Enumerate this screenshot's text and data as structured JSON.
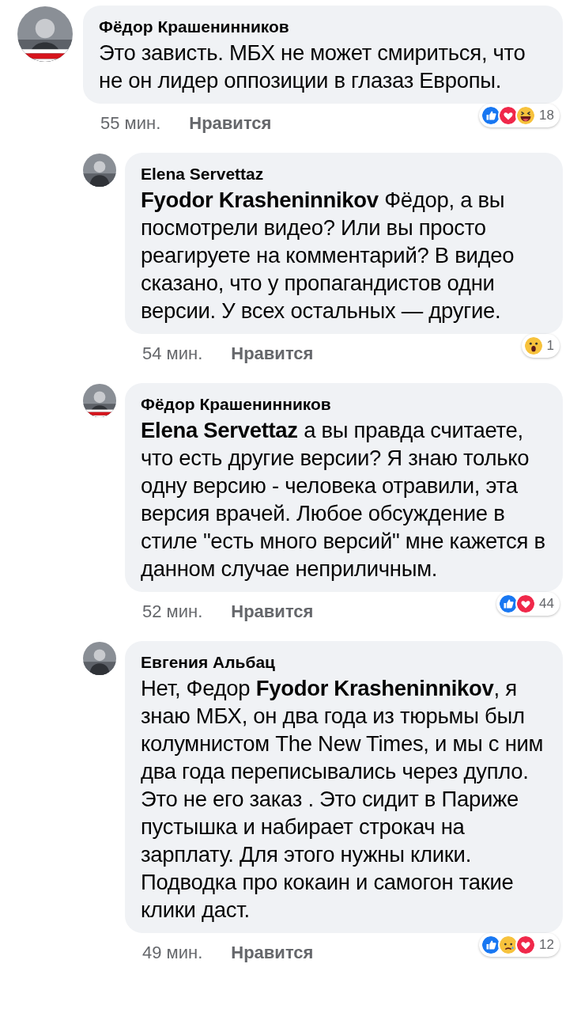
{
  "comments": [
    {
      "kind": "top",
      "author": "Фёдор Крашенинников",
      "avatar_frame": true,
      "text": "Это зависть. МБХ не может смириться, что не он лидер оппозиции в глазаз Европы.",
      "time": "55 мин.",
      "like_label": "Нравится",
      "reactions": [
        {
          "kind": "like"
        },
        {
          "kind": "love"
        },
        {
          "kind": "haha"
        }
      ],
      "reaction_count": "18"
    },
    {
      "kind": "reply",
      "author": "Elena Servettaz",
      "avatar_frame": false,
      "text": "**Fyodor Krasheninnikov** Фёдор, а вы посмотрели видео? Или вы просто реагируете на комментарий? В видео сказано, что у пропагандистов одни версии. У всех остальных — другие.",
      "time": "54 мин.",
      "like_label": "Нравится",
      "reactions": [
        {
          "kind": "wow"
        }
      ],
      "reaction_count": "1"
    },
    {
      "kind": "reply",
      "author": "Фёдор Крашенинников",
      "avatar_frame": true,
      "text": "**Elena Servettaz** а вы правда считаете, что есть другие версии? Я знаю только одну версию - человека отравили, эта версия врачей. Любое обсуждение в стиле \"есть много версий\" мне кажется в данном случае неприличным.",
      "time": "52 мин.",
      "like_label": "Нравится",
      "reactions": [
        {
          "kind": "like"
        },
        {
          "kind": "love"
        }
      ],
      "reaction_count": "44"
    },
    {
      "kind": "reply",
      "author": "Евгения Альбац",
      "avatar_frame": false,
      "text": "Нет, Федор **Fyodor Krasheninnikov**, я знаю МБХ, он два года из тюрьмы был колумнистом The New Times, и мы с ним два года переписывались через дупло. Это не его заказ . Это сидит в Париже пустышка и набирает строкач на зарплату. Для этого нужны клики. Подводка про кокаин и самогон такие клики даст.",
      "time": "49 мин.",
      "like_label": "Нравится",
      "reactions": [
        {
          "kind": "like"
        },
        {
          "kind": "sad"
        },
        {
          "kind": "love"
        }
      ],
      "reaction_count": "12"
    }
  ]
}
